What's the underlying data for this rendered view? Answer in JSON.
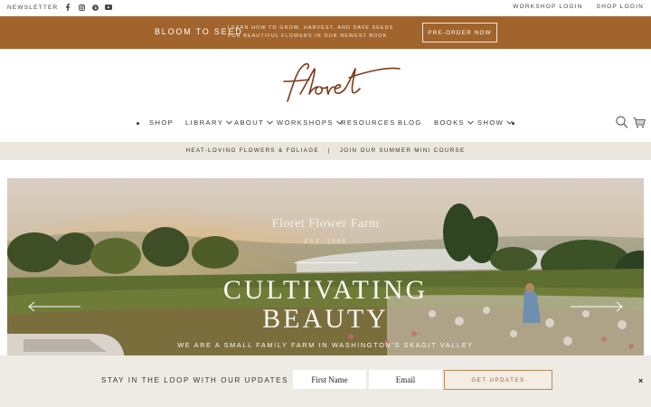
{
  "topbar": {
    "newsletter": "NEWSLETTER",
    "social_icons": [
      "facebook-icon",
      "instagram-icon",
      "pinterest-icon",
      "youtube-icon"
    ],
    "workshop_login": "WORKSHOP LOGIN",
    "shop_login": "SHOP LOGIN"
  },
  "promo": {
    "title": "BLOOM TO SEED",
    "description": "LEARN HOW TO GROW, HARVEST, AND SAVE SEEDS FOR BEAUTIFUL FLOWERS IN OUR NEWEST BOOK",
    "button": "PRE-ORDER NOW",
    "background": "#a1642d"
  },
  "logo": {
    "text": "floret"
  },
  "nav": {
    "items": [
      {
        "label": "SHOP",
        "has_dropdown": false
      },
      {
        "label": "LIBRARY",
        "has_dropdown": true
      },
      {
        "label": "ABOUT",
        "has_dropdown": true
      },
      {
        "label": "WORKSHOPS",
        "has_dropdown": true
      },
      {
        "label": "RESOURCES",
        "has_dropdown": false
      },
      {
        "label": "BLOG",
        "has_dropdown": false
      },
      {
        "label": "BOOKS",
        "has_dropdown": true
      },
      {
        "label": "SHOW",
        "has_dropdown": true
      }
    ],
    "icons": [
      "search-icon",
      "cart-icon"
    ]
  },
  "subbar": {
    "left": "HEAT-LOVING FLOWERS & FOLIAGE",
    "separator": "|",
    "right": "JOIN OUR SUMMER MINI COURSE"
  },
  "hero": {
    "farm_name": "Floret Flower Farm",
    "established": "EST. 2008",
    "headline_line1": "CULTIVATING",
    "headline_line2": "BEAUTY",
    "tagline": "WE ARE A SMALL FAMILY FARM IN WASHINGTON'S SKAGIT VALLEY"
  },
  "newsletter_bar": {
    "label": "STAY IN THE LOOP WITH OUR UPDATES",
    "first_name_placeholder": "First Name",
    "email_placeholder": "Email",
    "submit": "GET UPDATES",
    "close": "×"
  },
  "colors": {
    "accent": "#a1642d",
    "subbar_bg": "#ebe7de",
    "newsletter_bg": "#eeebe4"
  }
}
